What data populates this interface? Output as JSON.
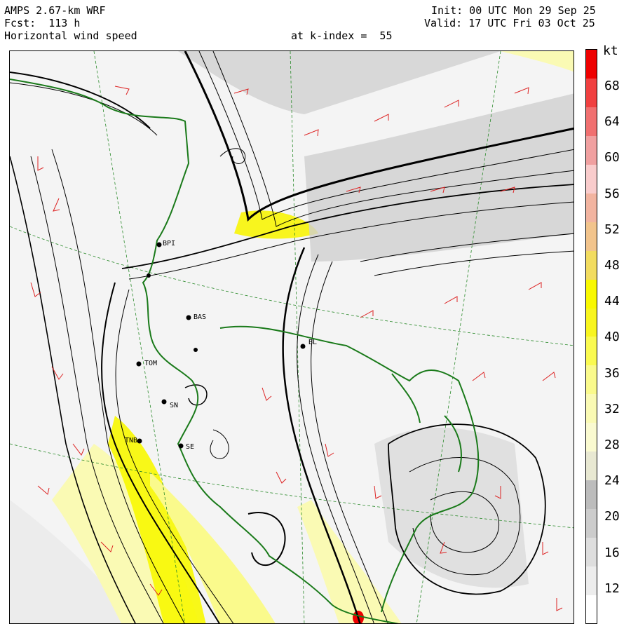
{
  "header": {
    "model": "AMPS 2.67-km WRF",
    "forecast": "Fcst:  113 h",
    "field": "Horizontal wind speed",
    "level": "at k-index =  55",
    "init": "Init: 00 UTC Mon 29 Sep 25",
    "valid": "Valid: 17 UTC Fri 03 Oct 25"
  },
  "colorbar": {
    "unit": "kt",
    "ticks": [
      "68",
      "64",
      "60",
      "56",
      "52",
      "48",
      "44",
      "40",
      "36",
      "32",
      "28",
      "24",
      "20",
      "16",
      "12"
    ],
    "colors": [
      "#ffffff",
      "#ededed",
      "#dedede",
      "#cccccc",
      "#bcbcbc",
      "#e8e8d2",
      "#fafad0",
      "#fafab4",
      "#fafa8c",
      "#fafa50",
      "#f8f51e",
      "#f8f800",
      "#f2dc60",
      "#f2c48c",
      "#f2b4a0",
      "#f9cccc",
      "#f0a0a0",
      "#f07070",
      "#f04040",
      "#ee0000"
    ],
    "colors_legend_order": "bottom-to-top"
  },
  "stations": [
    {
      "label": "BPI"
    },
    {
      "label": "BAS"
    },
    {
      "label": "BL"
    },
    {
      "label": "TOM"
    },
    {
      "label": "SN"
    },
    {
      "label": "TNB"
    },
    {
      "label": "SE"
    }
  ],
  "map_colors": {
    "streamline": "#000000",
    "coastline": "#1a7a1a",
    "barb": "#dd2222",
    "latlon_grid": "#2a8a2a"
  }
}
